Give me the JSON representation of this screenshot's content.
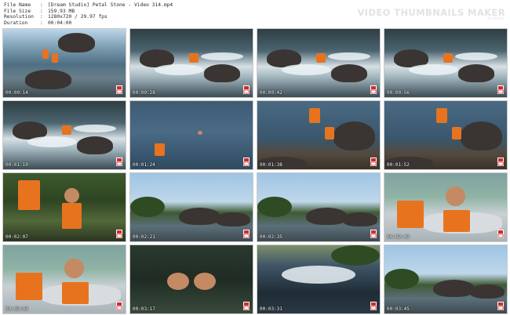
{
  "meta": {
    "rows": [
      {
        "key": "File Name",
        "sep": ":",
        "value": "[Dream Studio] Petal Stone - Video 314.mp4"
      },
      {
        "key": "File Size",
        "sep": ":",
        "value": "159.93 MB"
      },
      {
        "key": "Resolution",
        "sep": ":",
        "value": "1280x720 / 29.97 fps"
      },
      {
        "key": "Duration",
        "sep": ":",
        "value": "00:04:00"
      }
    ]
  },
  "brand": {
    "title": "VIDEO THUMBNAILS MAKER",
    "subtitle": "by tintin"
  },
  "thumbnails": [
    {
      "time": "00:00:14",
      "scene": "river"
    },
    {
      "time": "00:00:28",
      "scene": "rapids"
    },
    {
      "time": "00:00:42",
      "scene": "rapids"
    },
    {
      "time": "00:00:56",
      "scene": "rapids"
    },
    {
      "time": "00:01:10",
      "scene": "rapids"
    },
    {
      "time": "00:01:24",
      "scene": "water"
    },
    {
      "time": "00:01:38",
      "scene": "shore"
    },
    {
      "time": "00:01:52",
      "scene": "shore"
    },
    {
      "time": "00:02:07",
      "scene": "green"
    },
    {
      "time": "00:02:21",
      "scene": "sky"
    },
    {
      "time": "00:02:35",
      "scene": "sky"
    },
    {
      "time": "00:02:49",
      "scene": "boat"
    },
    {
      "time": "00:03:03",
      "scene": "boat"
    },
    {
      "time": "00:03:17",
      "scene": "dark"
    },
    {
      "time": "00:03:31",
      "scene": "foam"
    },
    {
      "time": "00:03:45",
      "scene": "sky"
    }
  ]
}
